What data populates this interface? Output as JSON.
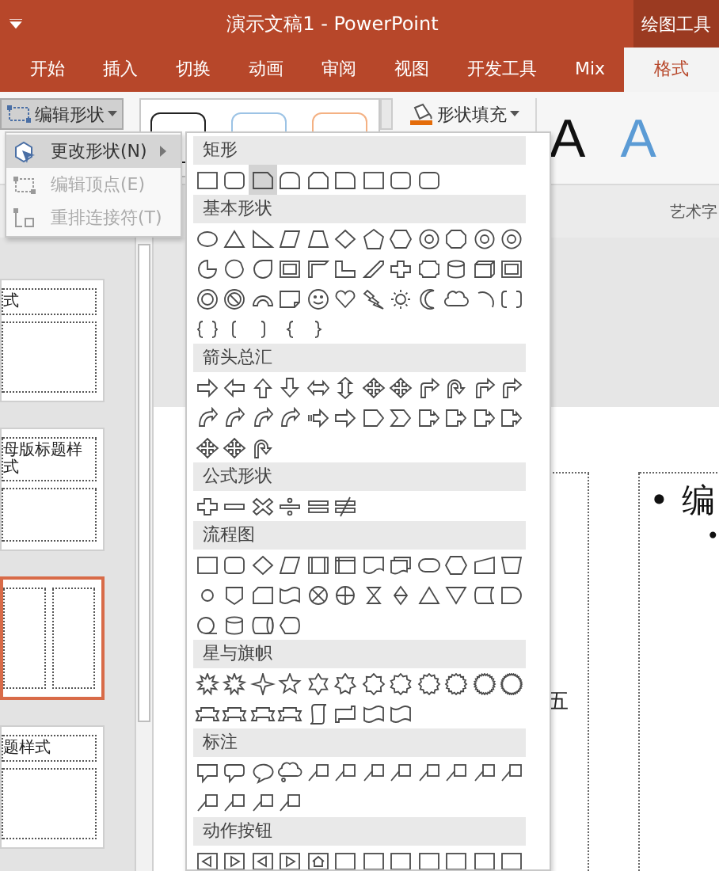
{
  "title_bar": {
    "title": "演示文稿1 - PowerPoint",
    "context_tab": "绘图工具"
  },
  "tabs": [
    {
      "label": "开始",
      "selected": false
    },
    {
      "label": "插入",
      "selected": false
    },
    {
      "label": "切换",
      "selected": false
    },
    {
      "label": "动画",
      "selected": false
    },
    {
      "label": "审阅",
      "selected": false
    },
    {
      "label": "视图",
      "selected": false
    },
    {
      "label": "开发工具",
      "selected": false
    },
    {
      "label": "Mix",
      "selected": false
    },
    {
      "label": "格式",
      "selected": true
    }
  ],
  "ribbon": {
    "edit_shape": {
      "label": "编辑形状",
      "pressed": true
    },
    "shape_fill": "形状填充",
    "wordart_samples": [
      {
        "letter": "A",
        "color": "#111111"
      },
      {
        "letter": "A",
        "color": "#5b9bd5"
      }
    ],
    "group_label": "艺术字"
  },
  "menu": [
    {
      "label": "更改形状(N)",
      "selected": true,
      "disabled": false,
      "submenu": true
    },
    {
      "label": "编辑顶点(E)",
      "selected": false,
      "disabled": true,
      "submenu": false
    },
    {
      "label": "重排连接符(T)",
      "selected": false,
      "disabled": true,
      "submenu": false
    }
  ],
  "shape_gallery": [
    {
      "title": "矩形",
      "shapes": [
        {
          "kind": "rect",
          "selected": false
        },
        {
          "kind": "rrect",
          "selected": false
        },
        {
          "kind": "snip",
          "selected": true
        },
        {
          "kind": "round2",
          "selected": false
        },
        {
          "kind": "snip2",
          "selected": false
        },
        {
          "kind": "round1",
          "selected": false
        },
        {
          "kind": "rect",
          "selected": false
        },
        {
          "kind": "rrect",
          "selected": false
        },
        {
          "kind": "rrect",
          "selected": false
        }
      ]
    },
    {
      "title": "基本形状",
      "shapes": [
        {
          "kind": "ellipse",
          "selected": false
        },
        {
          "kind": "triangle",
          "selected": false
        },
        {
          "kind": "rtriangle",
          "selected": false
        },
        {
          "kind": "parallelogram",
          "selected": false
        },
        {
          "kind": "trapezoid",
          "selected": false
        },
        {
          "kind": "diamond",
          "selected": false
        },
        {
          "kind": "pentagon",
          "selected": false
        },
        {
          "kind": "hexagon",
          "selected": false
        },
        {
          "kind": "polygon",
          "selected": false
        },
        {
          "kind": "octagon",
          "selected": false
        },
        {
          "kind": "polygon",
          "selected": false
        },
        {
          "kind": "polygon",
          "selected": false
        },
        {
          "kind": "pie",
          "selected": false
        },
        {
          "kind": "chord",
          "selected": false
        },
        {
          "kind": "teardrop",
          "selected": false
        },
        {
          "kind": "frame",
          "selected": false
        },
        {
          "kind": "halfframe",
          "selected": false
        },
        {
          "kind": "lshape",
          "selected": false
        },
        {
          "kind": "diagstripe",
          "selected": false
        },
        {
          "kind": "cross",
          "selected": false
        },
        {
          "kind": "plaque",
          "selected": false
        },
        {
          "kind": "can",
          "selected": false
        },
        {
          "kind": "cube",
          "selected": false
        },
        {
          "kind": "frame",
          "selected": false
        },
        {
          "kind": "donut",
          "selected": false
        },
        {
          "kind": "nosymbol",
          "selected": false
        },
        {
          "kind": "blockarc",
          "selected": false
        },
        {
          "kind": "folded",
          "selected": false
        },
        {
          "kind": "smiley",
          "selected": false
        },
        {
          "kind": "heart",
          "selected": false
        },
        {
          "kind": "lightning",
          "selected": false
        },
        {
          "kind": "sun",
          "selected": false
        },
        {
          "kind": "moon",
          "selected": false
        },
        {
          "kind": "cloud",
          "selected": false
        },
        {
          "kind": "arc",
          "selected": false
        },
        {
          "kind": "bracketpair",
          "selected": false
        },
        {
          "kind": "bracepair",
          "selected": false
        },
        {
          "kind": "lbracket",
          "selected": false
        },
        {
          "kind": "rbracket",
          "selected": false
        },
        {
          "kind": "lbrace",
          "selected": false
        },
        {
          "kind": "rbrace",
          "selected": false
        }
      ]
    },
    {
      "title": "箭头总汇",
      "shapes": [
        {
          "kind": "right",
          "selected": false
        },
        {
          "kind": "left",
          "selected": false
        },
        {
          "kind": "up",
          "selected": false
        },
        {
          "kind": "down",
          "selected": false
        },
        {
          "kind": "leftright",
          "selected": false
        },
        {
          "kind": "updown",
          "selected": false
        },
        {
          "kind": "quad",
          "selected": false
        },
        {
          "kind": "quad",
          "selected": false
        },
        {
          "kind": "bent",
          "selected": false
        },
        {
          "kind": "uturn",
          "selected": false
        },
        {
          "kind": "bent",
          "selected": false
        },
        {
          "kind": "bent",
          "selected": false
        },
        {
          "kind": "curved",
          "selected": false
        },
        {
          "kind": "curved",
          "selected": false
        },
        {
          "kind": "curved",
          "selected": false
        },
        {
          "kind": "curved",
          "selected": false
        },
        {
          "kind": "striped",
          "selected": false
        },
        {
          "kind": "right",
          "selected": false
        },
        {
          "kind": "homeplate",
          "selected": false
        },
        {
          "kind": "chevron",
          "selected": false
        },
        {
          "kind": "calloutarrow",
          "selected": false
        },
        {
          "kind": "calloutarrow",
          "selected": false
        },
        {
          "kind": "calloutarrow",
          "selected": false
        },
        {
          "kind": "calloutarrow",
          "selected": false
        },
        {
          "kind": "quad",
          "selected": false
        },
        {
          "kind": "quad",
          "selected": false
        },
        {
          "kind": "uturn",
          "selected": false
        }
      ]
    },
    {
      "title": "公式形状",
      "shapes": [
        {
          "kind": "cross",
          "selected": false
        },
        {
          "kind": "minus",
          "selected": false
        },
        {
          "kind": "multiply",
          "selected": false
        },
        {
          "kind": "divide",
          "selected": false
        },
        {
          "kind": "equal",
          "selected": false
        },
        {
          "kind": "notequal",
          "selected": false
        }
      ]
    },
    {
      "title": "流程图",
      "shapes": [
        {
          "kind": "rect",
          "selected": false
        },
        {
          "kind": "rrect",
          "selected": false
        },
        {
          "kind": "diamond",
          "selected": false
        },
        {
          "kind": "parallelogram",
          "selected": false
        },
        {
          "kind": "predefined",
          "selected": false
        },
        {
          "kind": "internal",
          "selected": false
        },
        {
          "kind": "document",
          "selected": false
        },
        {
          "kind": "multidoc",
          "selected": false
        },
        {
          "kind": "terminator",
          "selected": false
        },
        {
          "kind": "hexagon",
          "selected": false
        },
        {
          "kind": "manualinput",
          "selected": false
        },
        {
          "kind": "manualop",
          "selected": false
        },
        {
          "kind": "connector",
          "selected": false
        },
        {
          "kind": "offpage",
          "selected": false
        },
        {
          "kind": "card",
          "selected": false
        },
        {
          "kind": "tape",
          "selected": false
        },
        {
          "kind": "summing",
          "selected": false
        },
        {
          "kind": "or",
          "selected": false
        },
        {
          "kind": "collate",
          "selected": false
        },
        {
          "kind": "sort",
          "selected": false
        },
        {
          "kind": "triangle",
          "selected": false
        },
        {
          "kind": "merge",
          "selected": false
        },
        {
          "kind": "storeddata",
          "selected": false
        },
        {
          "kind": "delay",
          "selected": false
        },
        {
          "kind": "seqaccess",
          "selected": false
        },
        {
          "kind": "can",
          "selected": false
        },
        {
          "kind": "directaccess",
          "selected": false
        },
        {
          "kind": "display",
          "selected": false
        }
      ]
    },
    {
      "title": "星与旗帜",
      "shapes": [
        {
          "kind": "burst",
          "selected": false
        },
        {
          "kind": "burst",
          "selected": false
        },
        {
          "kind": "star4",
          "selected": false
        },
        {
          "kind": "star5",
          "selected": false
        },
        {
          "kind": "star6",
          "selected": false
        },
        {
          "kind": "star7",
          "selected": false
        },
        {
          "kind": "star8",
          "selected": false
        },
        {
          "kind": "star10",
          "selected": false
        },
        {
          "kind": "star12",
          "selected": false
        },
        {
          "kind": "star16",
          "selected": false
        },
        {
          "kind": "star24",
          "selected": false
        },
        {
          "kind": "star32",
          "selected": false
        },
        {
          "kind": "ribbon",
          "selected": false
        },
        {
          "kind": "ribbon",
          "selected": false
        },
        {
          "kind": "ribbon",
          "selected": false
        },
        {
          "kind": "ribbon",
          "selected": false
        },
        {
          "kind": "scroll",
          "selected": false
        },
        {
          "kind": "scrollh",
          "selected": false
        },
        {
          "kind": "wave",
          "selected": false
        },
        {
          "kind": "wave",
          "selected": false
        }
      ]
    },
    {
      "title": "标注",
      "shapes": [
        {
          "kind": "rectcallout",
          "selected": false
        },
        {
          "kind": "rrectcallout",
          "selected": false
        },
        {
          "kind": "ovalcallout",
          "selected": false
        },
        {
          "kind": "cloudcallout",
          "selected": false
        },
        {
          "kind": "linecallout",
          "selected": false
        },
        {
          "kind": "linecallout",
          "selected": false
        },
        {
          "kind": "linecallout",
          "selected": false
        },
        {
          "kind": "linecallout",
          "selected": false
        },
        {
          "kind": "linecallout",
          "selected": false
        },
        {
          "kind": "linecallout",
          "selected": false
        },
        {
          "kind": "linecallout",
          "selected": false
        },
        {
          "kind": "linecallout",
          "selected": false
        },
        {
          "kind": "linecallout",
          "selected": false
        },
        {
          "kind": "linecallout",
          "selected": false
        },
        {
          "kind": "linecallout",
          "selected": false
        },
        {
          "kind": "linecallout",
          "selected": false
        }
      ]
    },
    {
      "title": "动作按钮",
      "shapes": [
        {
          "kind": "actionback",
          "selected": false
        },
        {
          "kind": "actionforward",
          "selected": false
        },
        {
          "kind": "actionback",
          "selected": false
        },
        {
          "kind": "actionforward",
          "selected": false
        },
        {
          "kind": "actionhome",
          "selected": false
        },
        {
          "kind": "action",
          "selected": false
        },
        {
          "kind": "action",
          "selected": false
        },
        {
          "kind": "action",
          "selected": false
        },
        {
          "kind": "action",
          "selected": false
        },
        {
          "kind": "action",
          "selected": false
        },
        {
          "kind": "action",
          "selected": false
        },
        {
          "kind": "action",
          "selected": false
        }
      ]
    }
  ],
  "slides": [
    {
      "kind": "title",
      "title_lines": [
        "式"
      ],
      "selected": false
    },
    {
      "kind": "title",
      "title_lines": [
        "母版标题样",
        "式"
      ],
      "selected": false
    },
    {
      "kind": "split",
      "selected": true
    },
    {
      "kind": "title",
      "title_lines": [
        "题样式"
      ],
      "selected": false
    }
  ],
  "slide": {
    "left_text": "五",
    "bullets": [
      {
        "marker": "•",
        "text": "编",
        "children": [
          {
            "marker": "•"
          }
        ]
      }
    ]
  }
}
